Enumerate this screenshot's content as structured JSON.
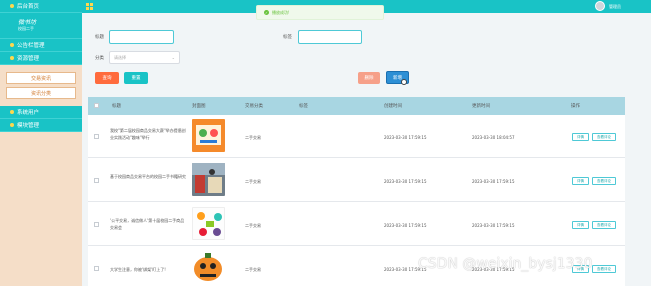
{
  "sidebar": {
    "items": [
      {
        "label": "后台首页"
      },
      {
        "label": "公告栏管理"
      },
      {
        "label": "资源管理"
      },
      {
        "label": "系统用户"
      },
      {
        "label": "模块管理"
      }
    ],
    "logo_title": "微书坊",
    "logo_sub": "校园二手",
    "sub_items": [
      {
        "label": "交易资讯"
      },
      {
        "label": "资讯分类"
      }
    ]
  },
  "header": {
    "user_name": "管理员"
  },
  "toast": {
    "message": "播放成功!"
  },
  "search": {
    "title_label": "标题",
    "label_label": "标签",
    "category_label": "分类",
    "category_placeholder": "请选择",
    "query_button": "查询",
    "reset_button": "重置",
    "delete_button": "删除",
    "add_button": "新增"
  },
  "table": {
    "headers": [
      "标题",
      "封面图",
      "交易分类",
      "标签",
      "创建时间",
      "更新时间",
      "操作"
    ],
    "rows": [
      {
        "title": "我校\"第二届校园商品交易大赛\"举办提倡创业实践活动\"趣味\"举行",
        "category": "二手交易",
        "tag": "",
        "created": "2023-03-30 17:59:15",
        "updated": "2023-03-30 18:04:57",
        "edit": "详情",
        "view": "查看评论"
      },
      {
        "title": "基于校园商品交易平台的校园二手书籍研究",
        "category": "二手交易",
        "tag": "",
        "created": "2023-03-30 17:59:15",
        "updated": "2023-03-30 17:59:15",
        "edit": "详情",
        "view": "查看评论"
      },
      {
        "title": "'公平交易，诚信做人'第十届校园二手商品交易会",
        "category": "二手交易",
        "tag": "",
        "created": "2023-03-30 17:59:15",
        "updated": "2023-03-30 17:59:15",
        "edit": "详情",
        "view": "查看评论"
      },
      {
        "title": "大学生注意，你被'绑架'盯上了!",
        "category": "二手交易",
        "tag": "",
        "created": "2023-03-30 17:59:15",
        "updated": "2023-03-30 17:59:15",
        "edit": "详情",
        "view": "查看评论"
      }
    ]
  },
  "watermark": "CSDN @weixin_bysj1330",
  "colors": {
    "primary": "#19c3c6",
    "sidebar_bg": "#f5dec8",
    "danger": "#ff6b3d",
    "accent_blue": "#2d8fd5"
  }
}
